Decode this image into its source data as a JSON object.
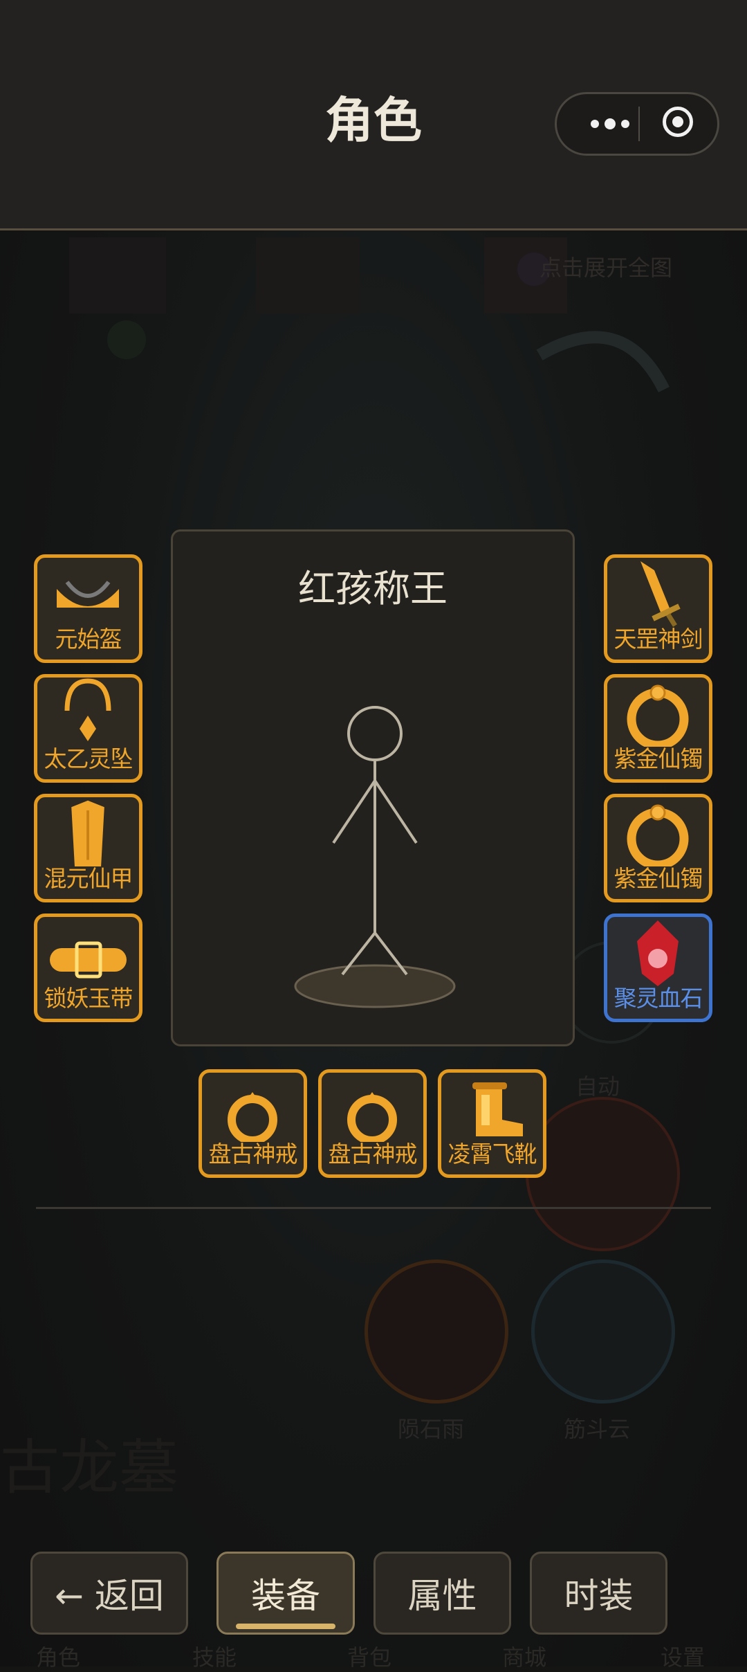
{
  "header": {
    "title": "角色"
  },
  "capsule": {
    "more_icon": "more-dots-icon",
    "close_icon": "target-circle-icon"
  },
  "background": {
    "hint": "点击展开全图",
    "skills": [
      "陨石雨",
      "筋斗云"
    ],
    "auto": "自动",
    "big_text": "古龙墓",
    "nav_labels": [
      "角色",
      "技能",
      "背包",
      "商城",
      "设置"
    ]
  },
  "character": {
    "name": "红孩称王"
  },
  "equipment": {
    "left": [
      {
        "label": "元始盔",
        "icon": "helmet-icon"
      },
      {
        "label": "太乙灵坠",
        "icon": "pendant-icon"
      },
      {
        "label": "混元仙甲",
        "icon": "armor-icon"
      },
      {
        "label": "锁妖玉带",
        "icon": "belt-icon"
      }
    ],
    "right": [
      {
        "label": "天罡神剑",
        "icon": "sword-icon"
      },
      {
        "label": "紫金仙镯",
        "icon": "bracelet-icon"
      },
      {
        "label": "紫金仙镯",
        "icon": "bracelet-icon"
      },
      {
        "label": "聚灵血石",
        "icon": "red-gem-icon"
      }
    ],
    "bottom": [
      {
        "label": "盘古神戒",
        "icon": "ring-icon"
      },
      {
        "label": "盘古神戒",
        "icon": "ring-icon"
      },
      {
        "label": "凌霄飞靴",
        "icon": "boot-icon"
      }
    ]
  },
  "tabs": {
    "back": "← 返回",
    "equip": "装备",
    "attr": "属性",
    "fashion": "时装",
    "active": "装备"
  },
  "colors": {
    "slot_border": "#e39a1f",
    "slot_special": "#3e73cf",
    "accent": "#d8b36a"
  }
}
